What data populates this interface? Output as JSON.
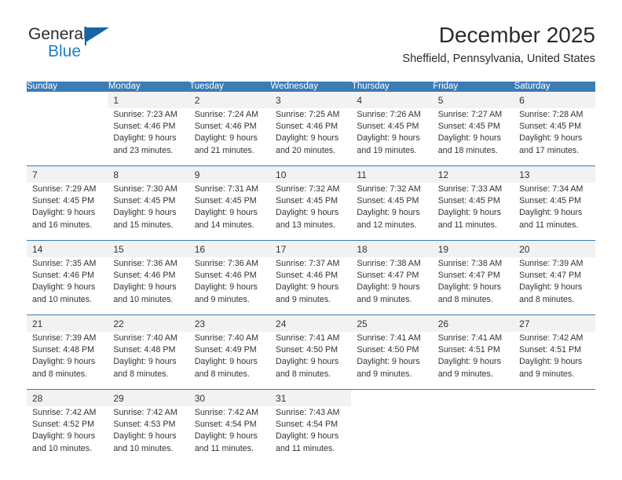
{
  "brand": {
    "name_part1": "General",
    "name_part2": "Blue",
    "accent_color": "#1565a8"
  },
  "header": {
    "title": "December 2025",
    "subtitle": "Sheffield, Pennsylvania, United States"
  },
  "theme": {
    "header_blue": "#3b7cb5",
    "date_band": "#f2f2f2",
    "text": "#333333"
  },
  "weekday_headers": [
    "Sunday",
    "Monday",
    "Tuesday",
    "Wednesday",
    "Thursday",
    "Friday",
    "Saturday"
  ],
  "weeks": [
    {
      "days": [
        {
          "date": "",
          "sunrise": "",
          "sunset": "",
          "daylight": ""
        },
        {
          "date": "1",
          "sunrise": "Sunrise: 7:23 AM",
          "sunset": "Sunset: 4:46 PM",
          "daylight": "Daylight: 9 hours and 23 minutes."
        },
        {
          "date": "2",
          "sunrise": "Sunrise: 7:24 AM",
          "sunset": "Sunset: 4:46 PM",
          "daylight": "Daylight: 9 hours and 21 minutes."
        },
        {
          "date": "3",
          "sunrise": "Sunrise: 7:25 AM",
          "sunset": "Sunset: 4:46 PM",
          "daylight": "Daylight: 9 hours and 20 minutes."
        },
        {
          "date": "4",
          "sunrise": "Sunrise: 7:26 AM",
          "sunset": "Sunset: 4:45 PM",
          "daylight": "Daylight: 9 hours and 19 minutes."
        },
        {
          "date": "5",
          "sunrise": "Sunrise: 7:27 AM",
          "sunset": "Sunset: 4:45 PM",
          "daylight": "Daylight: 9 hours and 18 minutes."
        },
        {
          "date": "6",
          "sunrise": "Sunrise: 7:28 AM",
          "sunset": "Sunset: 4:45 PM",
          "daylight": "Daylight: 9 hours and 17 minutes."
        }
      ]
    },
    {
      "days": [
        {
          "date": "7",
          "sunrise": "Sunrise: 7:29 AM",
          "sunset": "Sunset: 4:45 PM",
          "daylight": "Daylight: 9 hours and 16 minutes."
        },
        {
          "date": "8",
          "sunrise": "Sunrise: 7:30 AM",
          "sunset": "Sunset: 4:45 PM",
          "daylight": "Daylight: 9 hours and 15 minutes."
        },
        {
          "date": "9",
          "sunrise": "Sunrise: 7:31 AM",
          "sunset": "Sunset: 4:45 PM",
          "daylight": "Daylight: 9 hours and 14 minutes."
        },
        {
          "date": "10",
          "sunrise": "Sunrise: 7:32 AM",
          "sunset": "Sunset: 4:45 PM",
          "daylight": "Daylight: 9 hours and 13 minutes."
        },
        {
          "date": "11",
          "sunrise": "Sunrise: 7:32 AM",
          "sunset": "Sunset: 4:45 PM",
          "daylight": "Daylight: 9 hours and 12 minutes."
        },
        {
          "date": "12",
          "sunrise": "Sunrise: 7:33 AM",
          "sunset": "Sunset: 4:45 PM",
          "daylight": "Daylight: 9 hours and 11 minutes."
        },
        {
          "date": "13",
          "sunrise": "Sunrise: 7:34 AM",
          "sunset": "Sunset: 4:45 PM",
          "daylight": "Daylight: 9 hours and 11 minutes."
        }
      ]
    },
    {
      "days": [
        {
          "date": "14",
          "sunrise": "Sunrise: 7:35 AM",
          "sunset": "Sunset: 4:46 PM",
          "daylight": "Daylight: 9 hours and 10 minutes."
        },
        {
          "date": "15",
          "sunrise": "Sunrise: 7:36 AM",
          "sunset": "Sunset: 4:46 PM",
          "daylight": "Daylight: 9 hours and 10 minutes."
        },
        {
          "date": "16",
          "sunrise": "Sunrise: 7:36 AM",
          "sunset": "Sunset: 4:46 PM",
          "daylight": "Daylight: 9 hours and 9 minutes."
        },
        {
          "date": "17",
          "sunrise": "Sunrise: 7:37 AM",
          "sunset": "Sunset: 4:46 PM",
          "daylight": "Daylight: 9 hours and 9 minutes."
        },
        {
          "date": "18",
          "sunrise": "Sunrise: 7:38 AM",
          "sunset": "Sunset: 4:47 PM",
          "daylight": "Daylight: 9 hours and 9 minutes."
        },
        {
          "date": "19",
          "sunrise": "Sunrise: 7:38 AM",
          "sunset": "Sunset: 4:47 PM",
          "daylight": "Daylight: 9 hours and 8 minutes."
        },
        {
          "date": "20",
          "sunrise": "Sunrise: 7:39 AM",
          "sunset": "Sunset: 4:47 PM",
          "daylight": "Daylight: 9 hours and 8 minutes."
        }
      ]
    },
    {
      "days": [
        {
          "date": "21",
          "sunrise": "Sunrise: 7:39 AM",
          "sunset": "Sunset: 4:48 PM",
          "daylight": "Daylight: 9 hours and 8 minutes."
        },
        {
          "date": "22",
          "sunrise": "Sunrise: 7:40 AM",
          "sunset": "Sunset: 4:48 PM",
          "daylight": "Daylight: 9 hours and 8 minutes."
        },
        {
          "date": "23",
          "sunrise": "Sunrise: 7:40 AM",
          "sunset": "Sunset: 4:49 PM",
          "daylight": "Daylight: 9 hours and 8 minutes."
        },
        {
          "date": "24",
          "sunrise": "Sunrise: 7:41 AM",
          "sunset": "Sunset: 4:50 PM",
          "daylight": "Daylight: 9 hours and 8 minutes."
        },
        {
          "date": "25",
          "sunrise": "Sunrise: 7:41 AM",
          "sunset": "Sunset: 4:50 PM",
          "daylight": "Daylight: 9 hours and 9 minutes."
        },
        {
          "date": "26",
          "sunrise": "Sunrise: 7:41 AM",
          "sunset": "Sunset: 4:51 PM",
          "daylight": "Daylight: 9 hours and 9 minutes."
        },
        {
          "date": "27",
          "sunrise": "Sunrise: 7:42 AM",
          "sunset": "Sunset: 4:51 PM",
          "daylight": "Daylight: 9 hours and 9 minutes."
        }
      ]
    },
    {
      "days": [
        {
          "date": "28",
          "sunrise": "Sunrise: 7:42 AM",
          "sunset": "Sunset: 4:52 PM",
          "daylight": "Daylight: 9 hours and 10 minutes."
        },
        {
          "date": "29",
          "sunrise": "Sunrise: 7:42 AM",
          "sunset": "Sunset: 4:53 PM",
          "daylight": "Daylight: 9 hours and 10 minutes."
        },
        {
          "date": "30",
          "sunrise": "Sunrise: 7:42 AM",
          "sunset": "Sunset: 4:54 PM",
          "daylight": "Daylight: 9 hours and 11 minutes."
        },
        {
          "date": "31",
          "sunrise": "Sunrise: 7:43 AM",
          "sunset": "Sunset: 4:54 PM",
          "daylight": "Daylight: 9 hours and 11 minutes."
        },
        {
          "date": "",
          "sunrise": "",
          "sunset": "",
          "daylight": ""
        },
        {
          "date": "",
          "sunrise": "",
          "sunset": "",
          "daylight": ""
        },
        {
          "date": "",
          "sunrise": "",
          "sunset": "",
          "daylight": ""
        }
      ]
    }
  ]
}
